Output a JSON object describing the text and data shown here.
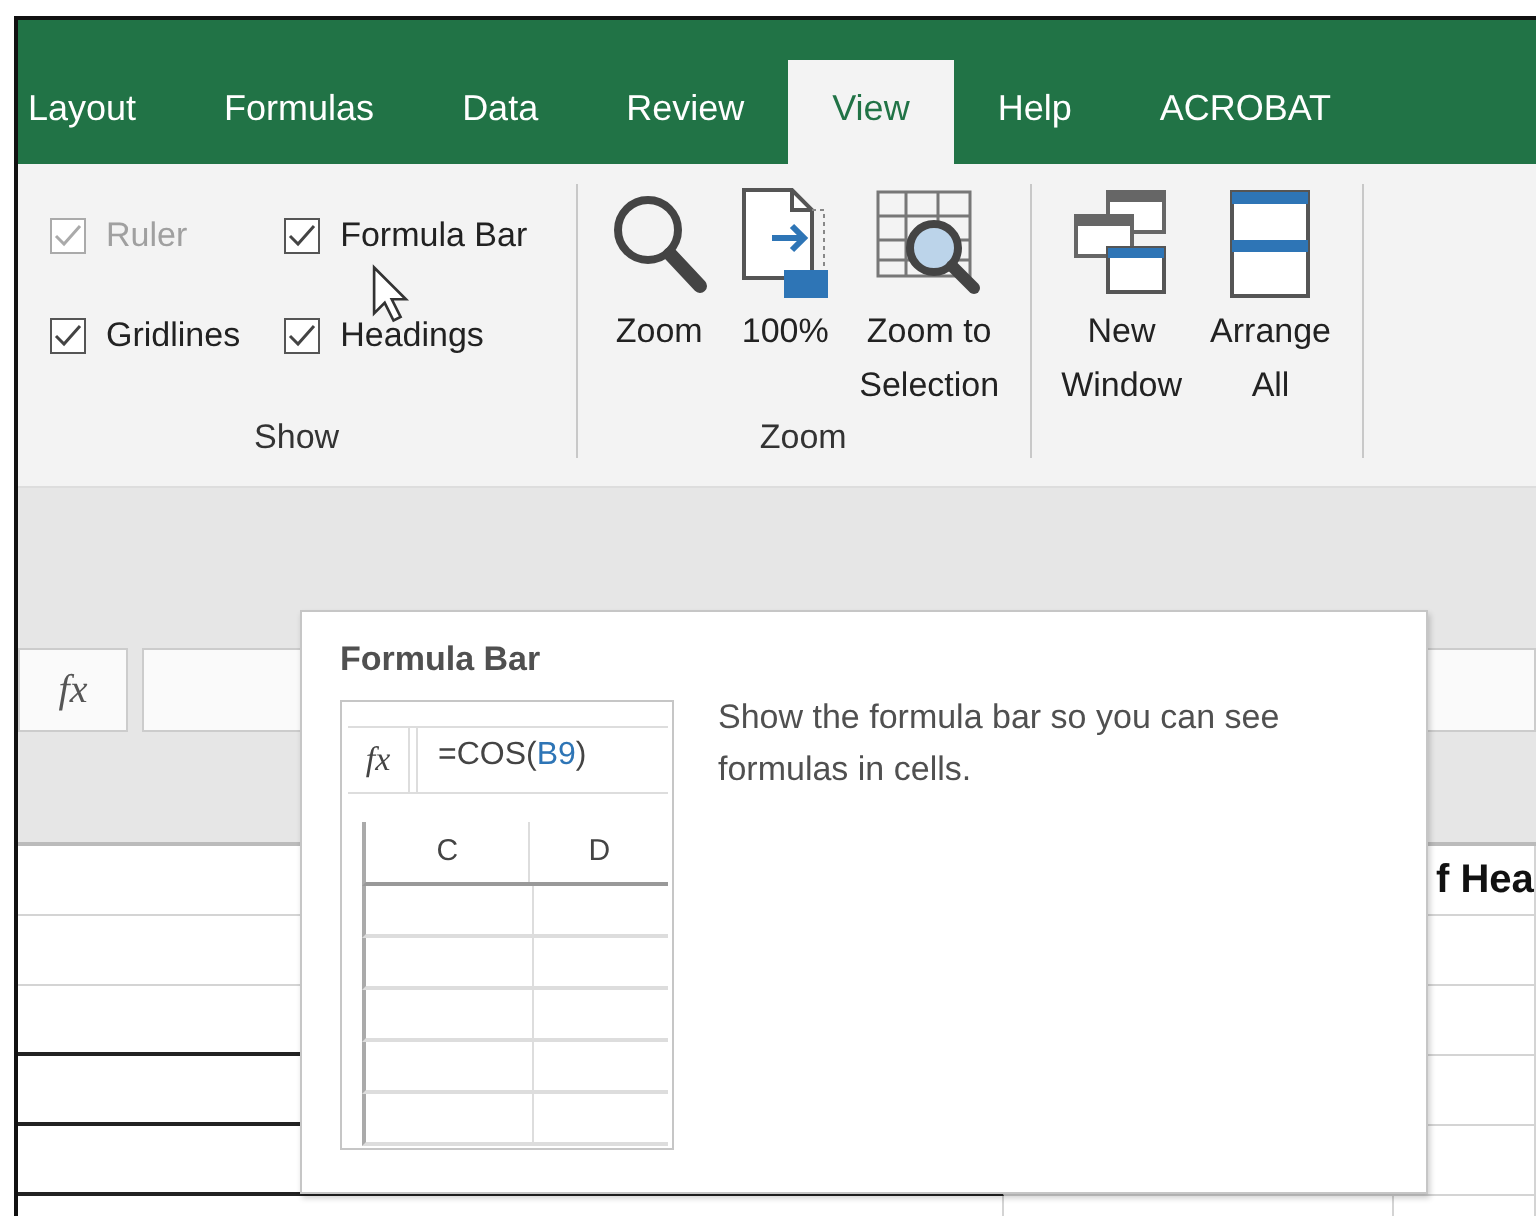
{
  "ribbon_tabs": [
    {
      "label": "Layout",
      "selected": false
    },
    {
      "label": "Formulas",
      "selected": false
    },
    {
      "label": "Data",
      "selected": false
    },
    {
      "label": "Review",
      "selected": false
    },
    {
      "label": "View",
      "selected": true
    },
    {
      "label": "Help",
      "selected": false
    },
    {
      "label": "ACROBAT",
      "selected": false
    }
  ],
  "ribbon_groups": [
    {
      "label": "Show",
      "items": [
        {
          "kind": "checkbox",
          "label": "Ruler",
          "checked": true,
          "disabled": true
        },
        {
          "kind": "checkbox",
          "label": "Formula Bar",
          "checked": true,
          "disabled": false
        },
        {
          "kind": "checkbox",
          "label": "Gridlines",
          "checked": true,
          "disabled": false
        },
        {
          "kind": "checkbox",
          "label": "Headings",
          "checked": true,
          "disabled": false
        }
      ]
    },
    {
      "label": "Zoom",
      "items": [
        {
          "kind": "large-button",
          "lines": [
            "Zoom"
          ]
        },
        {
          "kind": "large-button",
          "lines": [
            "100%"
          ]
        },
        {
          "kind": "large-button",
          "lines": [
            "Zoom to",
            "Selection"
          ]
        }
      ]
    },
    {
      "items": [
        {
          "kind": "large-button",
          "lines": [
            "New",
            "Window"
          ]
        },
        {
          "kind": "large-button",
          "lines": [
            "Arrange",
            "All"
          ]
        }
      ]
    }
  ],
  "formula_bar": {
    "fx_label": "fx"
  },
  "grid": {
    "rows": [
      {
        "cells": [
          "",
          "",
          "f Hea"
        ]
      },
      {
        "cells": [
          "",
          "",
          ""
        ]
      },
      {
        "cells": [
          "",
          "",
          ""
        ]
      },
      {
        "cells": [
          "",
          "",
          ""
        ]
      },
      {
        "cells": [
          "",
          "",
          ""
        ]
      },
      {
        "cells": [
          "",
          "",
          ""
        ]
      }
    ]
  },
  "tooltip": {
    "title": "Formula Bar",
    "description": "Show the formula bar so you can see formulas in cells.",
    "illustration": {
      "fx_label": "fx",
      "formula_parts": [
        {
          "kind": "plain",
          "text": "=COS("
        },
        {
          "kind": "reference",
          "text": "B9"
        },
        {
          "kind": "plain",
          "text": ")"
        }
      ],
      "columns": [
        "C",
        "D"
      ]
    }
  }
}
